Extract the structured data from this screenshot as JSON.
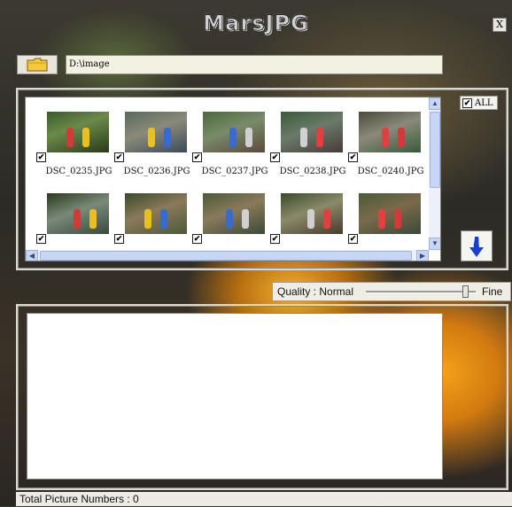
{
  "app": {
    "title": "MarsJPG",
    "close_label": "X"
  },
  "folder": {
    "icon": "folder-icon",
    "path": "D:\\image"
  },
  "thumbnails": [
    {
      "filename": "DSC_0235.JPG",
      "checked": true
    },
    {
      "filename": "DSC_0236.JPG",
      "checked": true
    },
    {
      "filename": "DSC_0237.JPG",
      "checked": true
    },
    {
      "filename": "DSC_0238.JPG",
      "checked": true
    },
    {
      "filename": "DSC_0240.JPG",
      "checked": true
    },
    {
      "filename": "",
      "checked": true
    },
    {
      "filename": "",
      "checked": true
    },
    {
      "filename": "",
      "checked": true
    },
    {
      "filename": "",
      "checked": true
    },
    {
      "filename": "",
      "checked": true
    }
  ],
  "select_all": {
    "label": "ALL",
    "checked": true
  },
  "add_button": {
    "icon": "arrow-down-icon"
  },
  "quality": {
    "label": "Quality : Normal",
    "end_label": "Fine",
    "level": 0.93
  },
  "status": {
    "text": "Total Picture Numbers : 0"
  },
  "colors": {
    "scroll": "#c8d6f6",
    "arrow": "#1a3fd0",
    "folder": "#f5c93a"
  }
}
